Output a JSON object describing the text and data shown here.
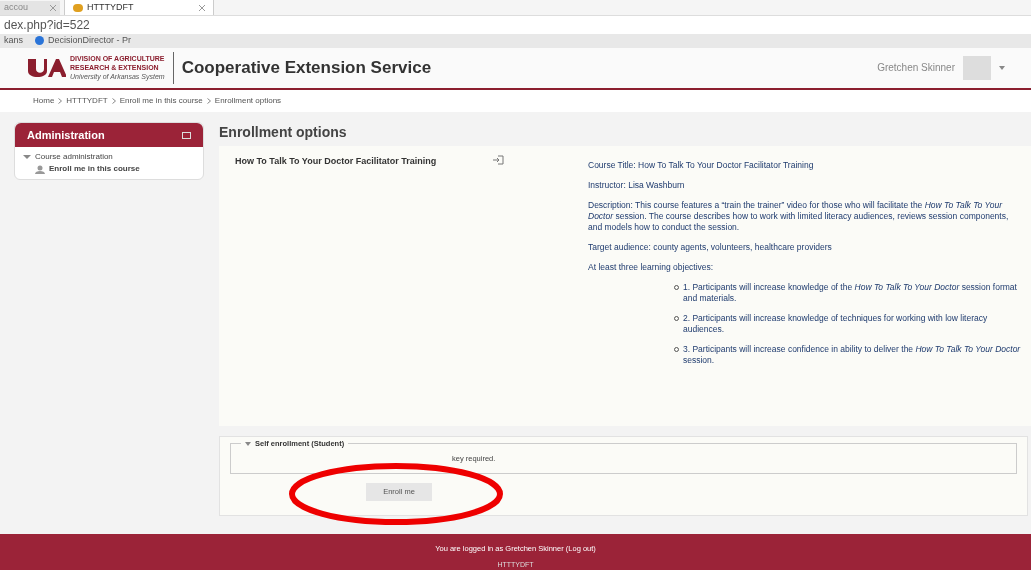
{
  "browser": {
    "tabs": [
      {
        "label": "accou",
        "selected": false
      },
      {
        "label": "HTTTYDFT",
        "selected": true
      }
    ],
    "address": "dex.php?id=522",
    "bookmarks": [
      "kans",
      "DecisionDirector - Pr"
    ]
  },
  "header": {
    "logo_lines": [
      "DIVISION OF AGRICULTURE",
      "RESEARCH & EXTENSION",
      "University of Arkansas System"
    ],
    "site_name": "Cooperative Extension Service",
    "user_name": "Gretchen Skinner"
  },
  "breadcrumb": [
    "Home",
    "HTTTYDFT",
    "Enroll me in this course",
    "Enrollment options"
  ],
  "sidebar": {
    "title": "Administration",
    "items": [
      {
        "label": "Course administration",
        "expanded": true,
        "children": [
          {
            "label": "Enroll me in this course"
          }
        ]
      }
    ]
  },
  "main": {
    "heading": "Enrollment options",
    "course_name": "How To Talk To Your Doctor Facilitator Training",
    "summary": [
      "Course Title: How To Talk To Your Doctor Facilitator Training",
      "Instructor: Lisa Washburn",
      "Description: This course features a “train the trainer” video for those who will facilitate the *How To Talk To Your Doctor* session. The course describes how to work with limited literacy audiences, reviews session components, and models how to conduct the session.",
      "Target audience: county agents, volunteers, healthcare providers",
      "At least three learning objectives:"
    ],
    "objectives": [
      "1. Participants will increase knowledge of the *How To Talk To Your Doctor* session format and materials.",
      "2. Participants will increase knowledge of techniques for working with low literacy audiences.",
      "3. Participants will increase confidence in ability to deliver the *How To Talk To Your Doctor* session."
    ],
    "enrolment": {
      "legend": "Self enrollment (Student)",
      "expanded": true,
      "note": "key required.",
      "button": "Enroll me"
    }
  },
  "footer": {
    "logged_in": "You are logged in as Gretchen Skinner (Log out)",
    "course": "HTTTYDFT"
  }
}
